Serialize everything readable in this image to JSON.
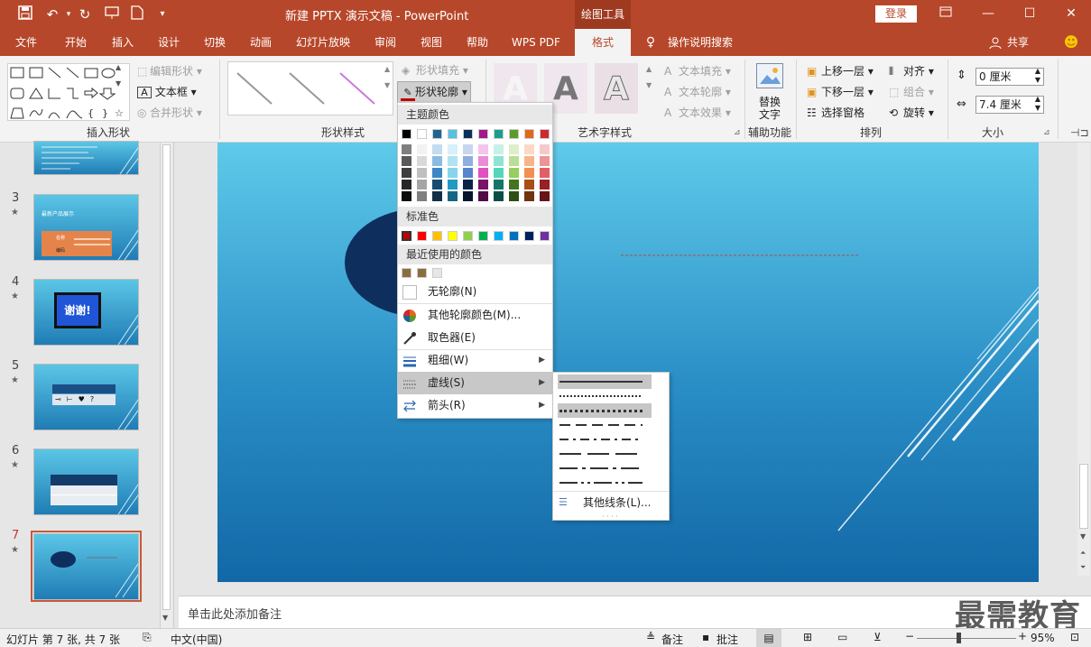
{
  "titlebar": {
    "title": "新建 PPTX 演示文稿  -  PowerPoint",
    "context_tab": "绘图工具",
    "login": "登录"
  },
  "tabs": [
    "文件",
    "开始",
    "插入",
    "设计",
    "切换",
    "动画",
    "幻灯片放映",
    "审阅",
    "视图",
    "帮助",
    "WPS PDF",
    "格式"
  ],
  "tell_me": "操作说明搜索",
  "share": "共享",
  "ribbon": {
    "insert_shapes": {
      "label": "插入形状",
      "edit_shape": "编辑形状",
      "text_box": "文本框",
      "merge_shapes": "合并形状"
    },
    "shape_styles": {
      "label": "形状样式",
      "fill": "形状填充",
      "outline": "形状轮廓"
    },
    "wordart": {
      "label": "艺术字样式",
      "text_fill": "文本填充",
      "text_outline": "文本轮廓",
      "text_effects": "文本效果",
      "sample": "A"
    },
    "accessibility": {
      "label": "辅助功能",
      "alt_text_1": "替换",
      "alt_text_2": "文字"
    },
    "arrange": {
      "label": "排列",
      "bring_forward": "上移一层",
      "send_backward": "下移一层",
      "selection_pane": "选择窗格",
      "align": "对齐",
      "group": "组合",
      "rotate": "旋转"
    },
    "size": {
      "label": "大小",
      "height": "0 厘米",
      "width": "7.4 厘米"
    }
  },
  "slides": [
    {
      "num": "3",
      "star": "★",
      "title": "最新产品展示",
      "cell1": "名称",
      "cell2": "编码"
    },
    {
      "num": "4",
      "star": "★",
      "text": "谢谢!"
    },
    {
      "num": "5",
      "star": "★"
    },
    {
      "num": "6",
      "star": "★"
    },
    {
      "num": "7",
      "star": "★"
    }
  ],
  "notes_placeholder": "单击此处添加备注",
  "status": {
    "slide_info": "幻灯片 第 7 张, 共 7 张",
    "language": "中文(中国)",
    "notes": "备注",
    "comments": "批注",
    "zoom": "95%"
  },
  "outline_menu": {
    "theme_colors": "主题颜色",
    "standard_colors": "标准色",
    "recent_colors": "最近使用的颜色",
    "no_outline": "无轮廓(N)",
    "more_colors": "其他轮廓颜色(M)...",
    "eyedropper": "取色器(E)",
    "weight": "粗细(W)",
    "dashes": "虚线(S)",
    "arrows": "箭头(R)",
    "theme_top": [
      "#000000",
      "#ffffff",
      "#1f6391",
      "#56c1e3",
      "#0e2f5e",
      "#a3188c",
      "#1a9e8c",
      "#5b9b2a",
      "#e0681d",
      "#cc2930"
    ],
    "theme_shades": [
      [
        "#7f7f7f",
        "#f2f2f2",
        "#c4dcef",
        "#d7f0f9",
        "#c7d6ef",
        "#f4c5ea",
        "#c7f1e8",
        "#dcefc8",
        "#fbd9c4",
        "#f5c9cb"
      ],
      [
        "#595959",
        "#d9d9d9",
        "#8cbbe1",
        "#afe2f3",
        "#8fadde",
        "#ea8cd6",
        "#8ee4d2",
        "#bade93",
        "#f7b48a",
        "#ec9498"
      ],
      [
        "#3f3f3f",
        "#bfbfbf",
        "#3d87c5",
        "#86d4ee",
        "#5784cd",
        "#df52c1",
        "#55d6bb",
        "#97ce5e",
        "#f38f4f",
        "#e25f65"
      ],
      [
        "#262626",
        "#a5a5a5",
        "#174a6e",
        "#219ac3",
        "#0b2349",
        "#7a1269",
        "#137669",
        "#44741f",
        "#a84e15",
        "#992024"
      ],
      [
        "#0d0d0d",
        "#7f7f7f",
        "#103149",
        "#166782",
        "#071730",
        "#510c46",
        "#0d4f46",
        "#2d4e15",
        "#70340e",
        "#661518"
      ]
    ],
    "standard": [
      "#c00000",
      "#ff0000",
      "#ffc000",
      "#ffff00",
      "#92d050",
      "#00b050",
      "#00b0f0",
      "#0070c0",
      "#002060",
      "#7030a0"
    ],
    "recent": [
      "#8c6d3f",
      "#8c6d3f",
      "#e6e6e6"
    ]
  },
  "dash_menu": {
    "more_lines": "其他线条(L)..."
  }
}
